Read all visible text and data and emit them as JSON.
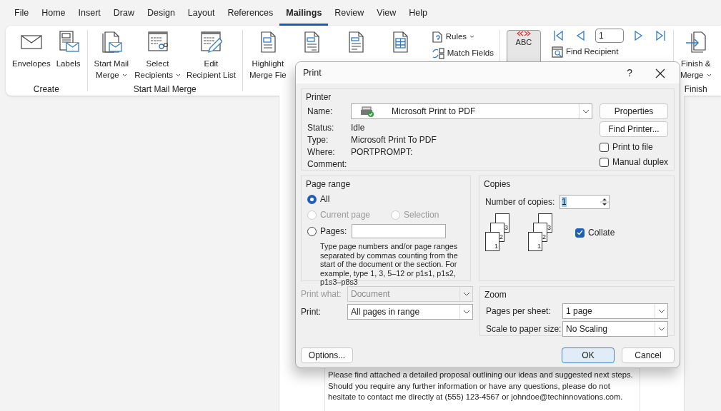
{
  "menu_tabs": [
    {
      "label": "File",
      "selected": false
    },
    {
      "label": "Home",
      "selected": false
    },
    {
      "label": "Insert",
      "selected": false
    },
    {
      "label": "Draw",
      "selected": false
    },
    {
      "label": "Design",
      "selected": false
    },
    {
      "label": "Layout",
      "selected": false
    },
    {
      "label": "References",
      "selected": false
    },
    {
      "label": "Mailings",
      "selected": true
    },
    {
      "label": "Review",
      "selected": false
    },
    {
      "label": "View",
      "selected": false
    },
    {
      "label": "Help",
      "selected": false
    }
  ],
  "ribbon_groups": [
    {
      "label": "Create",
      "items": [
        {
          "kind": "large",
          "lines": [
            "Envelopes"
          ],
          "dropdown": false
        },
        {
          "kind": "large",
          "lines": [
            "Labels"
          ],
          "dropdown": false
        }
      ]
    },
    {
      "label": "Start Mail Merge",
      "items": [
        {
          "kind": "large",
          "lines": [
            "Start Mail",
            "Merge"
          ],
          "dropdown": true
        },
        {
          "kind": "large",
          "lines": [
            "Select",
            "Recipients"
          ],
          "dropdown": true
        },
        {
          "kind": "large",
          "lines": [
            "Edit",
            "Recipient List"
          ],
          "dropdown": false
        }
      ]
    },
    {
      "items": [
        {
          "kind": "large",
          "lines": [
            "Highlight",
            "Merge Fie"
          ],
          "dropdown": false
        },
        {
          "kind": "large"
        },
        {
          "kind": "large"
        },
        {
          "kind": "large"
        },
        {
          "kind": "stack",
          "buttons": [
            {
              "label": "Rules",
              "dropdown": true
            },
            {
              "label": "Match Fields",
              "dropdown": false
            }
          ]
        }
      ]
    },
    {
      "items": [
        {
          "kind": "large",
          "icon_text": "ABC",
          "selected": true
        },
        {
          "kind": "nav",
          "record": "1",
          "buttons": [
            {
              "label": "Find Recipient",
              "dropdown": false
            }
          ]
        }
      ]
    },
    {
      "label": "Finish",
      "items": [
        {
          "kind": "large",
          "lines": [
            "Finish &",
            "Merge"
          ],
          "dropdown": true
        }
      ]
    }
  ],
  "document": {
    "paragraph": "Please find attached a detailed proposal outlining our ideas and suggested next steps. Should you require any further information or have any questions, please do not hesitate to contact me directly at (555) 123-4567 or johndoe@techinnovations.com."
  },
  "dialog": {
    "title": "Print",
    "help": "?",
    "printer": {
      "legend": "Printer",
      "name_label": "Name:",
      "name_value": "Microsoft Print to PDF",
      "info": [
        {
          "label": "Status:",
          "value": "Idle"
        },
        {
          "label": "Type:",
          "value": "Microsoft Print To PDF"
        },
        {
          "label": "Where:",
          "value": "PORTPROMPT:"
        },
        {
          "label": "Comment:"
        }
      ],
      "buttons": [
        "Properties",
        "Find Printer..."
      ],
      "options": [
        {
          "label": "Print to file",
          "checked": false
        },
        {
          "label": "Manual duplex",
          "checked": false
        }
      ]
    },
    "page_range": {
      "legend": "Page range",
      "options": [
        {
          "label": "All",
          "selected": true,
          "disabled": false
        },
        {
          "label": "Current page",
          "selected": false,
          "disabled": true
        },
        {
          "label": "Selection",
          "selected": false,
          "disabled": true
        },
        {
          "label": "Pages:",
          "selected": false,
          "disabled": false
        }
      ],
      "hint": "Type page numbers and/or page ranges separated by commas counting from the start of the document or the section. For example, type 1, 3, 5–12 or p1s1, p1s2, p1s3–p8s3"
    },
    "copies": {
      "legend": "Copies",
      "label": "Number of copies:",
      "value": "1",
      "value_selected": true,
      "stacks": [
        [
          "1",
          "2",
          "3"
        ],
        [
          "1",
          "2",
          "3"
        ]
      ],
      "collate": {
        "label": "Collate",
        "checked": true
      }
    },
    "print_what": {
      "label": "Print what:",
      "value": "Document",
      "disabled": true
    },
    "print": {
      "label": "Print:",
      "value": "All pages in range",
      "disabled": false
    },
    "zoom": {
      "legend": "Zoom",
      "rows": [
        {
          "label": "Pages per sheet:",
          "value": "1 page"
        },
        {
          "label": "Scale to paper size:",
          "value": "No Scaling"
        }
      ]
    },
    "buttons": [
      {
        "label": "Options...",
        "default": false
      },
      {
        "label": "OK",
        "default": true
      },
      {
        "label": "Cancel",
        "default": false
      }
    ]
  }
}
